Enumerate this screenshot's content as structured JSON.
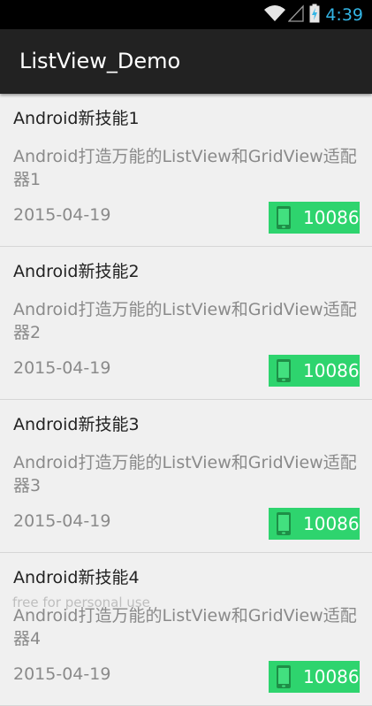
{
  "status_bar": {
    "time": "4:39",
    "icons": [
      "wifi-icon",
      "signal-icon",
      "battery-charging-icon"
    ],
    "colors": {
      "background": "#000000",
      "time": "#33b5e5"
    }
  },
  "action_bar": {
    "title": "ListView_Demo",
    "colors": {
      "background": "#222222",
      "text": "#ffffff"
    }
  },
  "list": {
    "items": [
      {
        "title": "Android新技能1",
        "description": "Android打造万能的ListView和GridView适配器1",
        "date": "2015-04-19",
        "phone": "10086"
      },
      {
        "title": "Android新技能2",
        "description": "Android打造万能的ListView和GridView适配器2",
        "date": "2015-04-19",
        "phone": "10086"
      },
      {
        "title": "Android新技能3",
        "description": "Android打造万能的ListView和GridView适配器3",
        "date": "2015-04-19",
        "phone": "10086"
      },
      {
        "title": "Android新技能4",
        "description": "Android打造万能的ListView和GridView适配器4",
        "date": "2015-04-19",
        "phone": "10086"
      }
    ],
    "colors": {
      "phone_button": "#2ed46e",
      "title": "#222222",
      "secondary_text": "#8a8a8a"
    }
  },
  "watermark": {
    "text": "free for personal use"
  }
}
